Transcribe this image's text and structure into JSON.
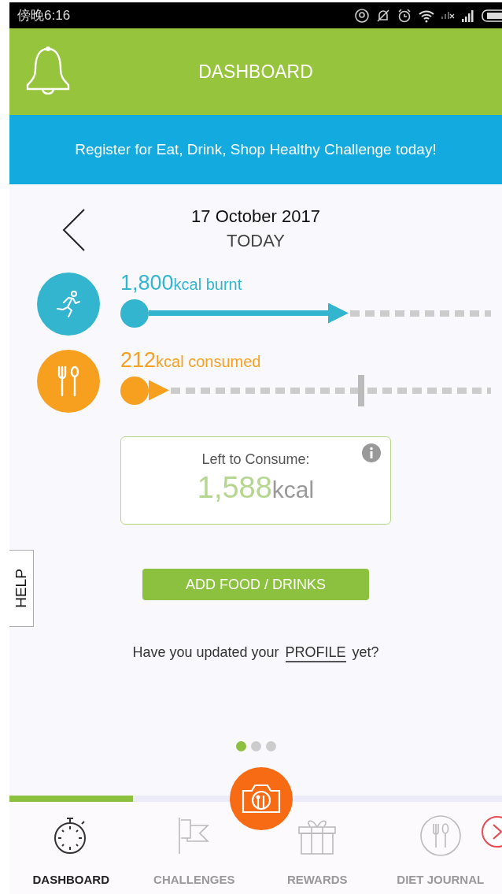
{
  "status_bar": {
    "time": "傍晚6:16"
  },
  "header": {
    "title": "DASHBOARD"
  },
  "banner": {
    "text": "Register for Eat, Drink, Shop Healthy Challenge today!"
  },
  "date": {
    "date": "17 October 2017",
    "label": "TODAY"
  },
  "metrics": [
    {
      "kind": "burnt",
      "value": "1,800",
      "unit": "kcal burnt",
      "color": "#33b5cf"
    },
    {
      "kind": "consumed",
      "value": "212",
      "unit": "kcal consumed",
      "color": "#f7a01f"
    }
  ],
  "summary": {
    "label": "Left to Consume:",
    "value": "1,588",
    "unit": "kcal"
  },
  "add_button": "ADD FOOD / DRINKS",
  "profile_prompt": {
    "before": "Have you updated your",
    "link": "PROFILE",
    "after": "yet?"
  },
  "help_tab": "HELP",
  "pager": [
    {
      "selected": true
    },
    {
      "selected": false
    },
    {
      "selected": false
    }
  ],
  "tabs": [
    {
      "kind": "stopwatch",
      "label": "DASHBOARD",
      "selected": true
    },
    {
      "kind": "flag",
      "label": "CHALLENGES",
      "selected": false
    },
    {
      "kind": "gift",
      "label": "REWARDS",
      "selected": false
    },
    {
      "kind": "utensils",
      "label": "DIET JOURNAL",
      "selected": false
    }
  ]
}
